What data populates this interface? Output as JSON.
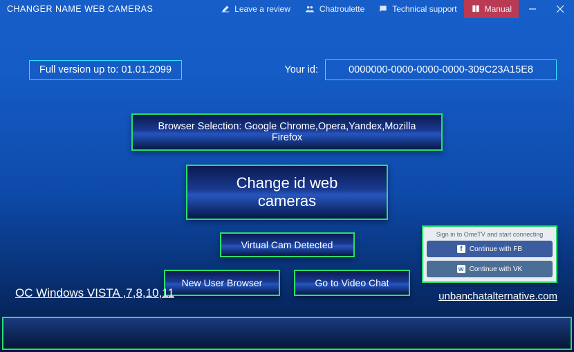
{
  "titlebar": {
    "title": "CHANGER NAME WEB CAMERAS",
    "review": "Leave a review",
    "chat": "Chatroulette",
    "support": "Technical support",
    "manual": "Manual"
  },
  "version_label": "Full version up to: 01.01.2099",
  "your_id_label": "Your id:",
  "your_id_value": "0000000-0000-0000-0000-309C23A15E8",
  "buttons": {
    "browser_selection": "Browser Selection: Google Chrome,Opera,Yandex,Mozilla Firefox",
    "change_id": "Change id  web cameras",
    "virtual_cam": "Virtual Cam Detected",
    "new_user": "New User Browser",
    "go_video": "Go to Video Chat"
  },
  "ometv": {
    "title": "Sign in to OmeTV and start connecting",
    "fb": "Continue with FB",
    "vk": "Continue with VK"
  },
  "os_label": "OC Windows VISTA ,7,8,10,11",
  "site_link": "unbanchatalternative.com"
}
